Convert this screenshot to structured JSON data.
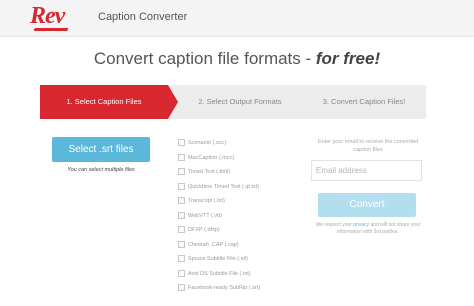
{
  "header": {
    "logo_text": "Rev",
    "app_name": "Caption Converter",
    "brand_color": "#d8272e"
  },
  "page": {
    "title_main": "Convert caption file formats - ",
    "title_emphasis": "for free!"
  },
  "steps": [
    {
      "label": "1. Select Caption Files",
      "active": true
    },
    {
      "label": "2. Select Output Formats",
      "active": false
    },
    {
      "label": "3. Convert Caption Files!",
      "active": false
    }
  ],
  "left": {
    "select_button": "Select .srt files",
    "hint": "You can select multiple files"
  },
  "formats": [
    {
      "label": "Scenarist (.scc)",
      "checked": false
    },
    {
      "label": "MacCaption (.mcc)",
      "checked": false
    },
    {
      "label": "Timed Text (.ttml)",
      "checked": false
    },
    {
      "label": "Quicktime Timed Text (.qt.txt)",
      "checked": false
    },
    {
      "label": "Transcript (.txt)",
      "checked": false
    },
    {
      "label": "WebVTT (.vtt)",
      "checked": false
    },
    {
      "label": "DFXP (.dfxp)",
      "checked": false
    },
    {
      "label": "Cheetah .CAP (.cap)",
      "checked": false
    },
    {
      "label": "Spruce Subtitle File (.stl)",
      "checked": false
    },
    {
      "label": "Avid DS Subtitle File (.txt)",
      "checked": false
    },
    {
      "label": "Facebook-ready SubRip (.srt)",
      "checked": false
    }
  ],
  "right": {
    "email_note": "Enter your email to receive the converted caption files",
    "email_placeholder": "Email address",
    "convert_button": "Convert",
    "privacy_before": "We respect your ",
    "privacy_link": "privacy",
    "privacy_after": " and will not share your information with 3rd parties."
  },
  "colors": {
    "accent_blue": "#5bb8db",
    "disabled_blue": "#b3def0",
    "step_bar": "#ececec"
  }
}
